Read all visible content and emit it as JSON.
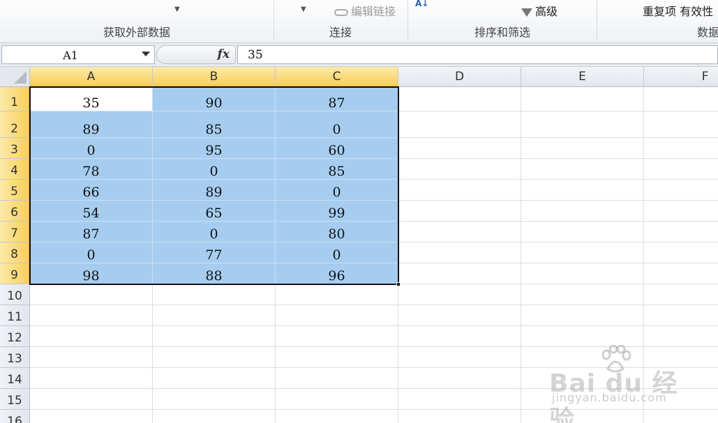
{
  "ribbon": {
    "groups": [
      {
        "label": "获取外部数据"
      },
      {
        "label": "连接",
        "items": [
          "编辑链接"
        ]
      },
      {
        "label": "排序和筛选",
        "items": [
          "高级"
        ]
      },
      {
        "label": "数据",
        "items": [
          "重复项 有效性"
        ]
      }
    ]
  },
  "formula_bar": {
    "name_box": "A1",
    "fx_label": "fx",
    "formula": "35"
  },
  "sheet": {
    "columns": [
      "A",
      "B",
      "C",
      "D",
      "E",
      "F"
    ],
    "rows": [
      "1",
      "2",
      "3",
      "4",
      "5",
      "6",
      "7",
      "8",
      "9",
      "10",
      "11",
      "12",
      "13",
      "14",
      "15",
      "16"
    ],
    "selected_columns": [
      "A",
      "B",
      "C"
    ],
    "selected_rows": 9,
    "active_cell": "A1",
    "data": [
      [
        "35",
        "90",
        "87"
      ],
      [
        "89",
        "85",
        "0"
      ],
      [
        "0",
        "95",
        "60"
      ],
      [
        "78",
        "0",
        "85"
      ],
      [
        "66",
        "89",
        "0"
      ],
      [
        "54",
        "65",
        "99"
      ],
      [
        "87",
        "0",
        "80"
      ],
      [
        "0",
        "77",
        "0"
      ],
      [
        "98",
        "88",
        "96"
      ]
    ]
  },
  "watermark": {
    "brand": "Bai du 经验",
    "url": "jingyan.baidu.com"
  },
  "colors": {
    "selection_fill": "#a6cdf0",
    "header_highlight": "#f8cf5c"
  }
}
